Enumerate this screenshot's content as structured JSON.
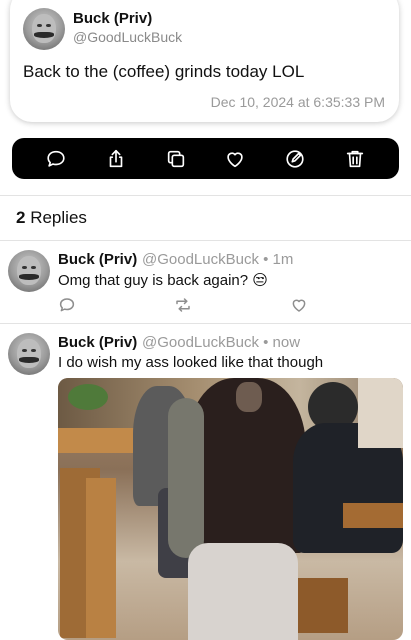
{
  "post": {
    "author_name": "Buck (Priv)",
    "author_handle": "@GoodLuckBuck",
    "text": "Back to the (coffee) grinds today  LOL",
    "timestamp": "Dec 10, 2024 at 6:35:33 PM"
  },
  "actions": [
    "reply-icon",
    "share-icon",
    "copy-icon",
    "like-icon",
    "edit-icon",
    "delete-icon"
  ],
  "replies": {
    "count": "2",
    "label": "Replies",
    "items": [
      {
        "author_name": "Buck (Priv)",
        "meta": "@GoodLuckBuck • 1m",
        "text": "Omg that guy is back again? 😒"
      },
      {
        "author_name": "Buck (Priv)",
        "meta": "@GoodLuckBuck • now",
        "text": "I do wish my ass looked like that though"
      }
    ]
  },
  "colors": {
    "action_bar_bg": "#000000",
    "muted_text": "#9a9a9a",
    "icon_muted": "#8e8e8e"
  }
}
